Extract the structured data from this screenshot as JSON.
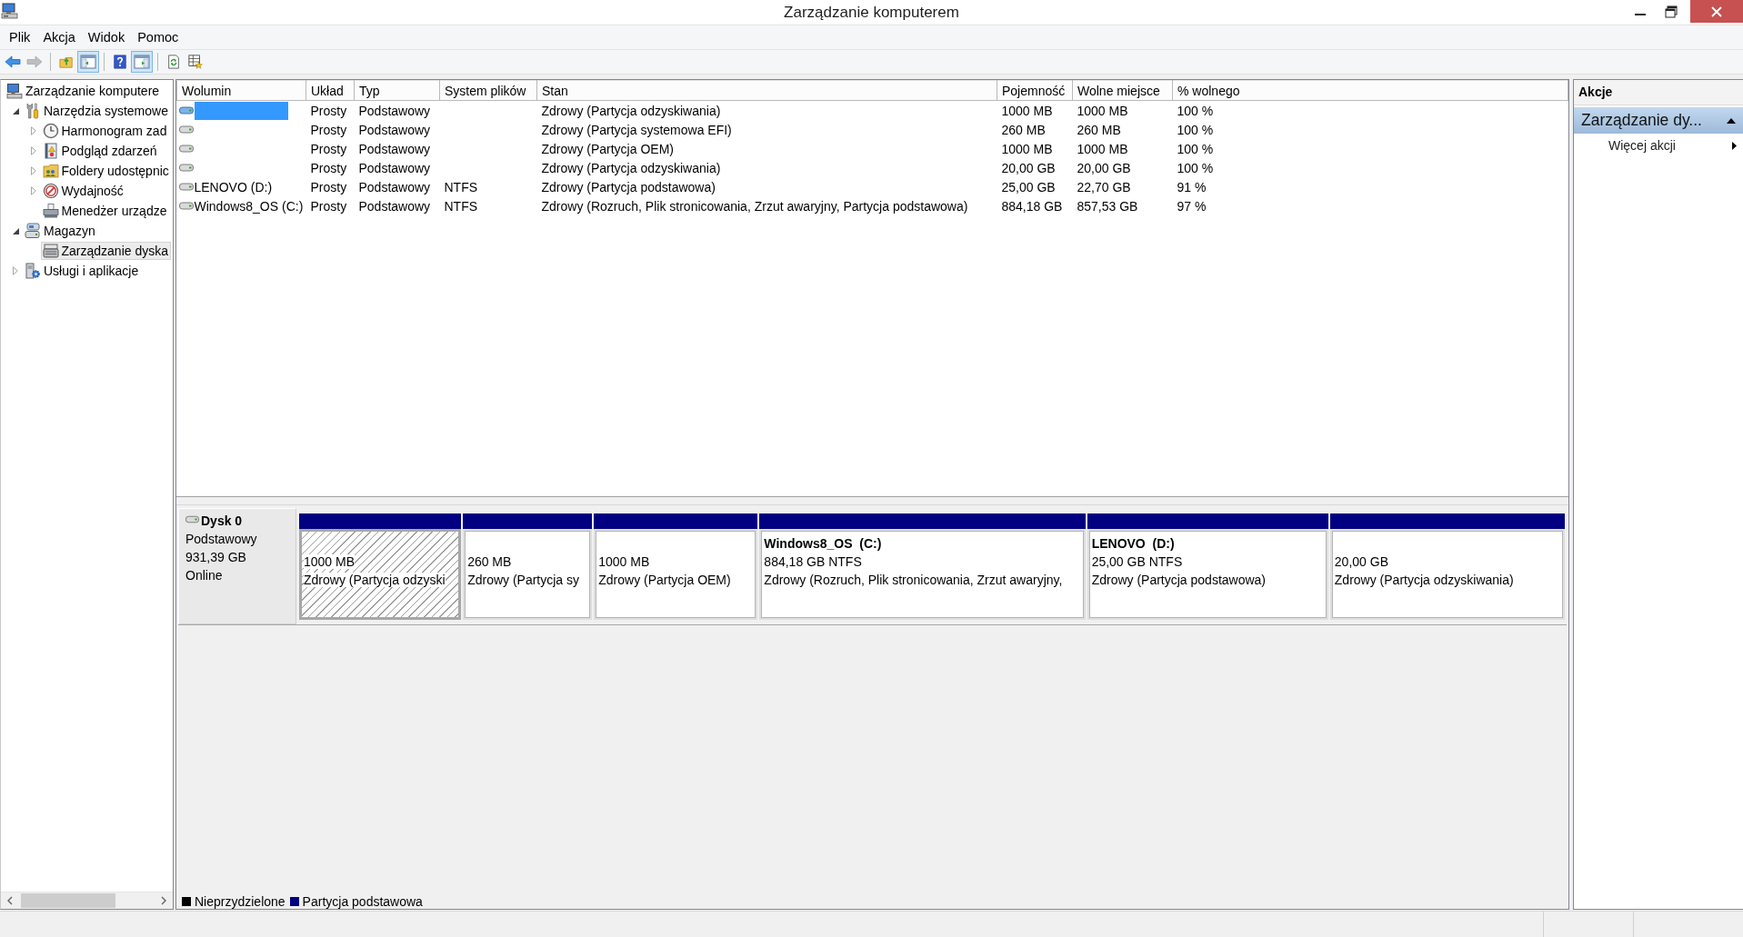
{
  "window": {
    "title": "Zarządzanie komputerem"
  },
  "menu": [
    {
      "label": "Plik"
    },
    {
      "label": "Akcja"
    },
    {
      "label": "Widok"
    },
    {
      "label": "Pomoc"
    }
  ],
  "toolbar": {
    "groups": [
      {
        "buttons": [
          {
            "kind": "back",
            "pressed": false,
            "disabled": false
          },
          {
            "kind": "forward",
            "pressed": false,
            "disabled": true
          }
        ]
      },
      {
        "buttons": [
          {
            "kind": "up",
            "pressed": false,
            "disabled": false
          },
          {
            "kind": "console-tree",
            "pressed": true,
            "disabled": false
          }
        ]
      },
      {
        "buttons": [
          {
            "kind": "help",
            "pressed": false,
            "disabled": false
          },
          {
            "kind": "action-pane",
            "pressed": true,
            "disabled": false
          }
        ]
      },
      {
        "buttons": [
          {
            "kind": "export",
            "pressed": false,
            "disabled": false
          },
          {
            "kind": "properties",
            "pressed": false,
            "disabled": false
          }
        ]
      }
    ]
  },
  "tree": {
    "items": [
      {
        "label": "Zarządzanie komputere",
        "kind": "computer",
        "selected": false,
        "children": [
          {
            "label": "Narzędzia systemowe",
            "kind": "tools",
            "expanded": true,
            "selected": false,
            "children": [
              {
                "label": "Harmonogram zad",
                "kind": "clock",
                "expanded": false,
                "selected": false
              },
              {
                "label": "Podgląd zdarzeń",
                "kind": "event-log",
                "expanded": false,
                "selected": false
              },
              {
                "label": "Foldery udostępnic",
                "kind": "shared-folders",
                "expanded": false,
                "selected": false
              },
              {
                "label": "Wydajność",
                "kind": "performance",
                "expanded": false,
                "selected": false
              },
              {
                "label": "Menedżer urządze",
                "kind": "devices",
                "selected": false
              }
            ]
          },
          {
            "label": "Magazyn",
            "kind": "storage",
            "expanded": true,
            "selected": false,
            "children": [
              {
                "label": "Zarządzanie dyska",
                "kind": "disk",
                "selected": true
              }
            ]
          },
          {
            "label": "Usługi i aplikacje",
            "kind": "services",
            "expanded": false,
            "selected": false
          }
        ]
      }
    ]
  },
  "volumes": {
    "columns": [
      "Wolumin",
      "Układ",
      "Typ",
      "System plików",
      "Stan",
      "Pojemność",
      "Wolne miejsce",
      "% wolnego"
    ],
    "rows": [
      {
        "layout": "Prosty",
        "type": "Podstawowy",
        "status": "Zdrowy (Partycja odzyskiwania)",
        "capacity": "1000 MB",
        "free": "1000 MB",
        "percent_free": "100 %",
        "selected": true
      },
      {
        "layout": "Prosty",
        "type": "Podstawowy",
        "status": "Zdrowy (Partycja systemowa EFI)",
        "capacity": "260 MB",
        "free": "260 MB",
        "percent_free": "100 %",
        "selected": false
      },
      {
        "layout": "Prosty",
        "type": "Podstawowy",
        "status": "Zdrowy (Partycja OEM)",
        "capacity": "1000 MB",
        "free": "1000 MB",
        "percent_free": "100 %",
        "selected": false
      },
      {
        "layout": "Prosty",
        "type": "Podstawowy",
        "status": "Zdrowy (Partycja odzyskiwania)",
        "capacity": "20,00 GB",
        "free": "20,00 GB",
        "percent_free": "100 %",
        "selected": false
      },
      {
        "volume": "LENOVO (D:)",
        "layout": "Prosty",
        "type": "Podstawowy",
        "filesystem": "NTFS",
        "status": "Zdrowy (Partycja podstawowa)",
        "capacity": "25,00 GB",
        "free": "22,70 GB",
        "percent_free": "91 %",
        "selected": false
      },
      {
        "volume": "Windows8_OS (C:)",
        "layout": "Prosty",
        "type": "Podstawowy",
        "filesystem": "NTFS",
        "status": "Zdrowy (Rozruch, Plik stronicowania, Zrzut awaryjny, Partycja podstawowa)",
        "capacity": "884,18 GB",
        "free": "857,53 GB",
        "percent_free": "97 %",
        "selected": false
      }
    ]
  },
  "disk_map": {
    "disks": [
      {
        "name": "Dysk 0",
        "type": "Podstawowy",
        "size": "931,39 GB",
        "state": "Online",
        "partitions": [
          {
            "size": "1000 MB",
            "status": "Zdrowy (Partycja odzyski",
            "selected": true
          },
          {
            "size": "260 MB",
            "status": "Zdrowy (Partycja sy",
            "selected": false
          },
          {
            "size": "1000 MB",
            "status": "Zdrowy (Partycja OEM)",
            "selected": false
          },
          {
            "name": "Windows8_OS  (C:)",
            "size": "884,18 GB NTFS",
            "status": "Zdrowy (Rozruch, Plik stronicowania, Zrzut awaryjny,",
            "selected": false
          },
          {
            "name": "LENOVO  (D:)",
            "size": "25,00 GB NTFS",
            "status": "Zdrowy (Partycja podstawowa)",
            "selected": false
          },
          {
            "size": "20,00 GB",
            "status": "Zdrowy (Partycja odzyskiwania)",
            "selected": false
          }
        ]
      }
    ],
    "legend": [
      {
        "label": "Nieprzydzielone",
        "color": "#000000"
      },
      {
        "label": "Partycja podstawowa",
        "color": "#000080"
      }
    ]
  },
  "actions": {
    "title": "Akcje",
    "sections": [
      {
        "title": "Zarządzanie dy...",
        "expanded": true,
        "items": [
          {
            "label": "Więcej akcji"
          }
        ]
      }
    ]
  }
}
